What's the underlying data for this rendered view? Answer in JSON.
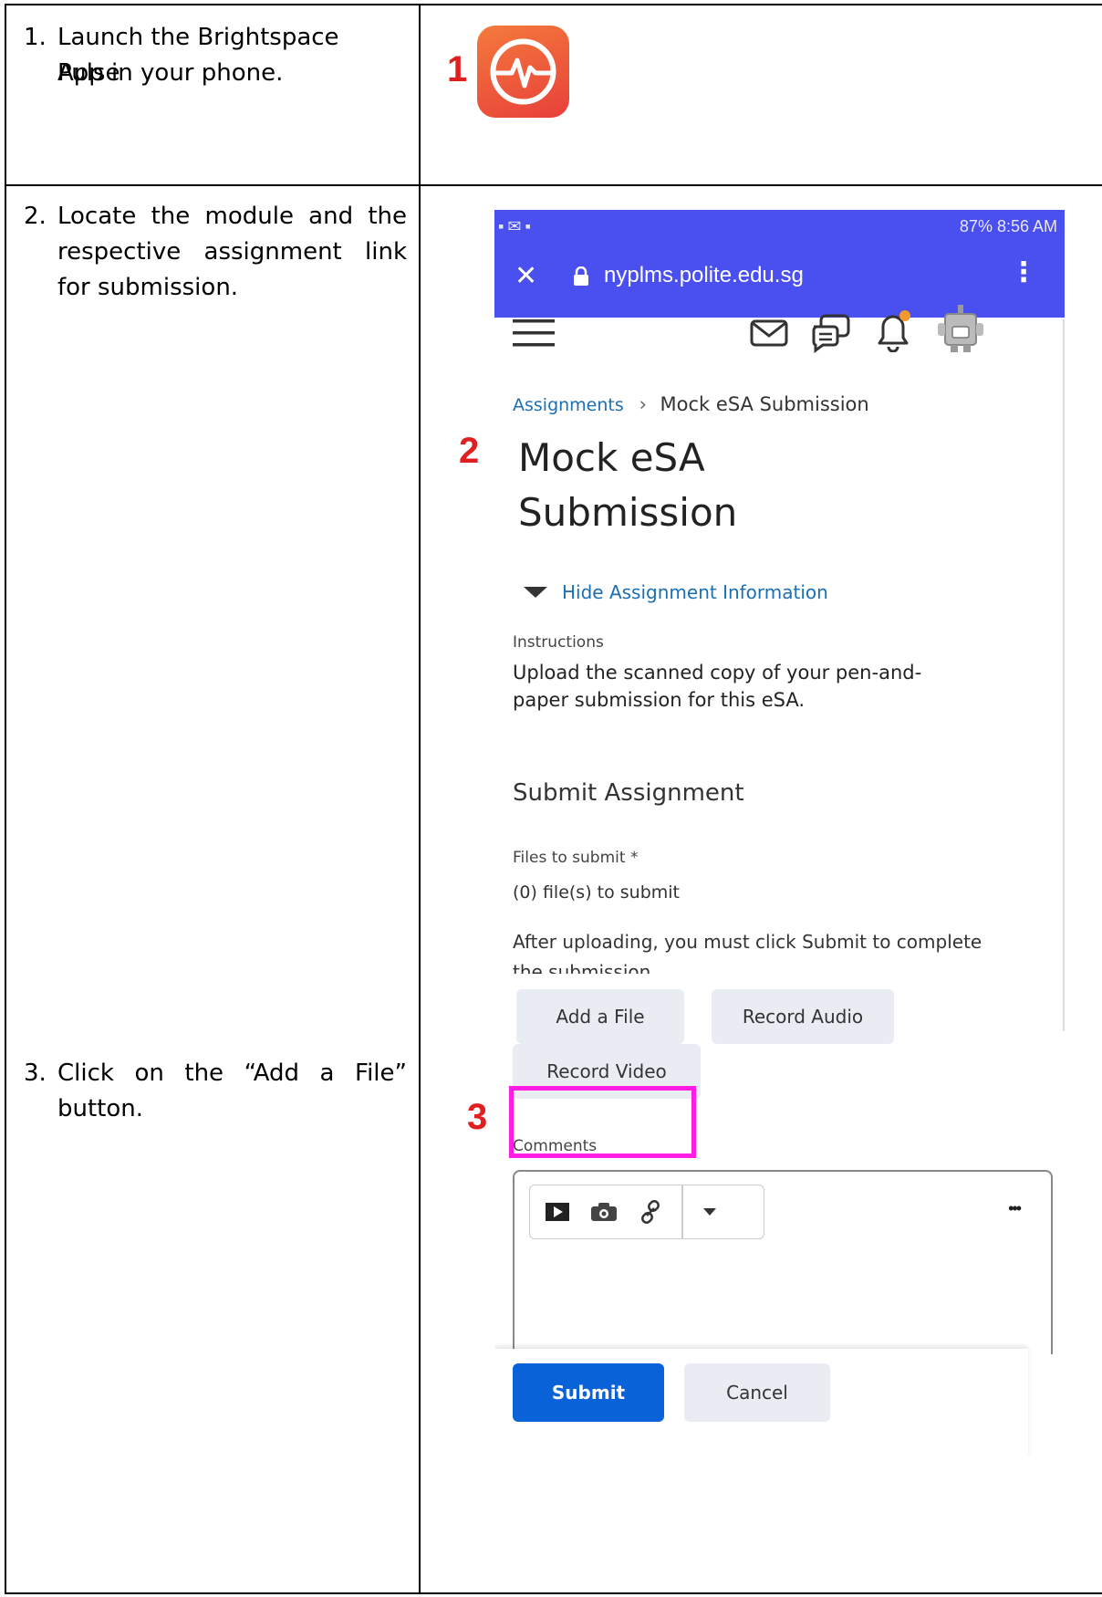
{
  "steps": [
    {
      "num": "1.",
      "lines": [
        "Launch the Brightspace Pulse",
        "App in your phone."
      ]
    },
    {
      "num": "2.",
      "lines": [
        "Locate the module and the",
        "respective assignment link",
        "for submission."
      ]
    },
    {
      "num": "3.",
      "lines": [
        "Click on the “Add a File”",
        "button."
      ]
    }
  ],
  "markers": [
    "1",
    "2",
    "3"
  ],
  "colors": {
    "marker": "#e02020",
    "highlight": "#ff1de6",
    "app_icon": "#f0553a",
    "status_bar": "#4a4ff0",
    "link": "#1a6fb5",
    "submit": "#0a62d8"
  },
  "phone": {
    "status": {
      "right": "87% 8:56 AM"
    },
    "url": "nyplms.polite.edu.sg",
    "icons": [
      "menu-icon",
      "mail-icon",
      "chat-icon",
      "bell-icon",
      "avatar"
    ],
    "breadcrumb": {
      "link": "Assignments",
      "sep": "›",
      "current": "Mock eSA Submission"
    },
    "title_lines": [
      "Mock eSA",
      "Submission"
    ],
    "toggle": "Hide Assignment Information",
    "instructions_label": "Instructions",
    "instructions_lines": [
      "Upload the scanned copy of your pen-and-",
      "paper submission for this eSA."
    ],
    "submit_heading": "Submit Assignment",
    "files_label": "Files to submit *",
    "files_count": "(0) file(s) to submit",
    "after_upload": "After uploading, you must click Submit to complete",
    "after_upload_cut": "the submission.",
    "buttons": {
      "add_file": "Add a File",
      "record_audio": "Record Audio",
      "record_video": "Record Video"
    },
    "comments_label": "Comments",
    "more": "•••",
    "submit": "Submit",
    "cancel": "Cancel"
  }
}
